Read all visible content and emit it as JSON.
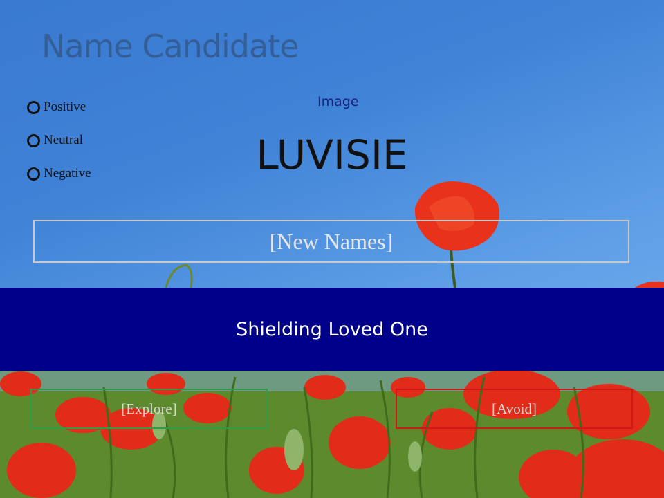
{
  "slide": {
    "title": "Name Candidate",
    "options": [
      {
        "label": "Positive"
      },
      {
        "label": "Neutral"
      },
      {
        "label": "Negative"
      }
    ],
    "image_label": "Image",
    "candidate_name": "LUVISIE",
    "new_names_label": "[New Names]",
    "band_text": "Shielding Loved One",
    "explore_label": "[Explore]",
    "avoid_label": "[Avoid]"
  },
  "colors": {
    "band": "#00008b",
    "explore_border": "#2e9a4a",
    "avoid_border": "#d01818",
    "poppy": "#e8321c"
  },
  "icons": {
    "background": "poppy-field-photo"
  }
}
